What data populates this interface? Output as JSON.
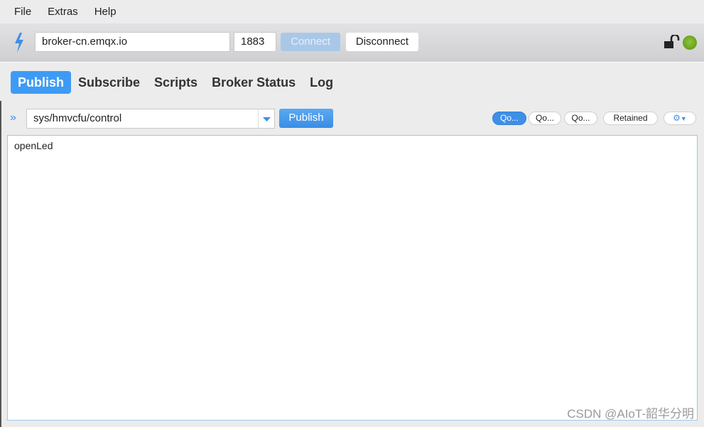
{
  "menu": [
    "File",
    "Extras",
    "Help"
  ],
  "connection": {
    "broker": "broker-cn.emqx.io",
    "port": "1883",
    "connect_label": "Connect",
    "disconnect_label": "Disconnect",
    "status": "connected",
    "status_color": "#6aa319"
  },
  "tabs": [
    {
      "label": "Publish",
      "active": true
    },
    {
      "label": "Subscribe"
    },
    {
      "label": "Scripts"
    },
    {
      "label": "Broker Status"
    },
    {
      "label": "Log"
    }
  ],
  "publish": {
    "topic": "sys/hmvcfu/control",
    "publish_label": "Publish",
    "qos": [
      "Qo...",
      "Qo...",
      "Qo..."
    ],
    "qos_selected": 0,
    "retained_label": "Retained",
    "payload": "openLed"
  },
  "watermark": "CSDN @AIoT-韶华分明"
}
